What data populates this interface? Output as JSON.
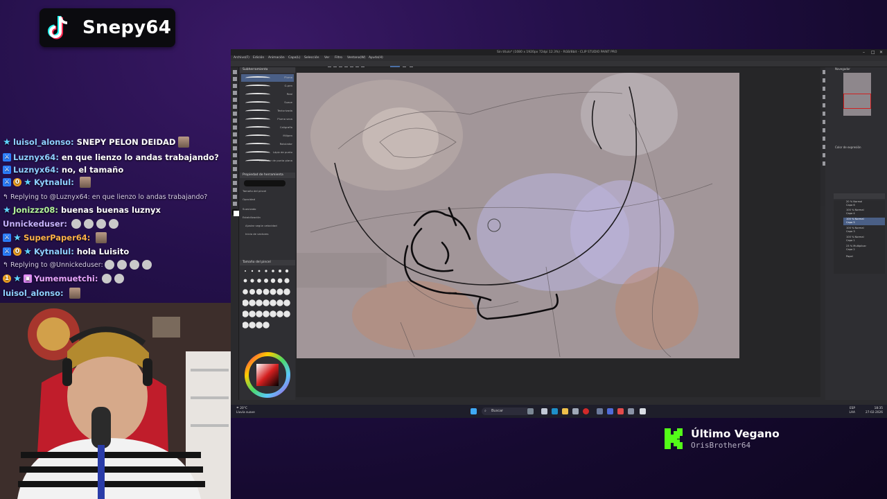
{
  "brand": {
    "platform_icon": "tiktok-icon",
    "channel_name": "Snepy64"
  },
  "chat": {
    "messages": [
      {
        "user": "luisol_alonso:",
        "user_color": "#8fd0ff",
        "text": "SNEPY PELON DEIDAD",
        "badges": [
          "star-badge"
        ]
      },
      {
        "user": "Luznyx64:",
        "user_color": "#8fd0ff",
        "text": "en que lienzo lo andas trabajando?",
        "badges": [
          "star-badge"
        ]
      },
      {
        "user": "Luznyx64:",
        "user_color": "#8fd0ff",
        "text": "no, el tamaño",
        "badges": [
          "star-badge"
        ]
      },
      {
        "user": "Kytnalul:",
        "user_color": "#8fd0ff",
        "text": "",
        "badges": [
          "mod-badge",
          "level-badge",
          "star-badge"
        ]
      },
      {
        "reply": "Replying to @Luznyx64: en que lienzo lo andas trabajando?"
      },
      {
        "user": "Jonizzz08:",
        "user_color": "#b3f59a",
        "text": "buenas buenas luznyx",
        "badges": [
          "star-badge"
        ]
      },
      {
        "user": "Unnickeduser:",
        "user_color": "#c8b5ff",
        "text": "",
        "badges": []
      },
      {
        "user": "SuperPaper64:",
        "user_color": "#ffb347",
        "text": "",
        "badges": [
          "mod-badge",
          "star-badge"
        ]
      },
      {
        "user": "Kytnalul:",
        "user_color": "#8fd0ff",
        "text": "hola Luisito",
        "badges": [
          "mod-badge",
          "level-badge",
          "star-badge"
        ]
      },
      {
        "reply": "Replying to @Unnickeduser:"
      },
      {
        "user": "Yumemuetchi:",
        "user_color": "#e9a6ff",
        "text": "",
        "badges": [
          "level-badge",
          "star-badge",
          "gift-badge"
        ]
      },
      {
        "user": "luisol_alonso:",
        "user_color": "#8fd0ff",
        "text": "",
        "badges": [
          "star-badge"
        ]
      }
    ]
  },
  "screen": {
    "window_title": "Sin título* (1080 x 1920px 72dpi 12.3%) - RGB/8bit - CLIP STUDIO PAINT PRO",
    "menu": [
      "Archivo(F)",
      "Edición",
      "Animación",
      "Capa(L)",
      "Selección",
      "Ver",
      "Filtro",
      "Ventana(W)",
      "Ayuda(H)"
    ],
    "subtool_panel_title": "Subherramienta",
    "brushes": [
      "Pluma",
      "G-pen",
      "Real",
      "Suave",
      "Texturizada",
      "Pluma seca",
      "Caligrafía",
      "Milipen",
      "Rotulador",
      "Lápiz de punto",
      "Marcador de punta plana"
    ],
    "tool_property_title": "Propiedad de herramienta",
    "tool_props": [
      "Tamaño del pincel",
      "Opacidad",
      "Suavizado",
      "Estabilización",
      "Ajustar según velocidad",
      "Inicio de vectores"
    ],
    "brush_size_title": "Tamaño del pincel",
    "navigator_title": "Navegador",
    "layers": [
      "20 % Normal",
      "Capa 6",
      "100 % Normal",
      "Capa 4",
      "100 % Normal",
      "Capa 5",
      "100 % Normal",
      "Capa 3",
      "100 % Normal",
      "Capa 1",
      "23 % Multiplicar",
      "Capa 2",
      "Papel"
    ],
    "color_panel_title": "Color de expresión",
    "taskbar": {
      "search_placeholder": "Buscar",
      "weather_temp": "20°C",
      "weather_desc": "Lluvia suave",
      "lang": "ESP",
      "lang2": "LAA",
      "time": "18:35",
      "date": "27-02-2026"
    }
  },
  "now_playing": {
    "icon": "kick-icon",
    "title": "Último Vegano",
    "artist": "OrisBrother64",
    "accent": "#53fc18"
  }
}
